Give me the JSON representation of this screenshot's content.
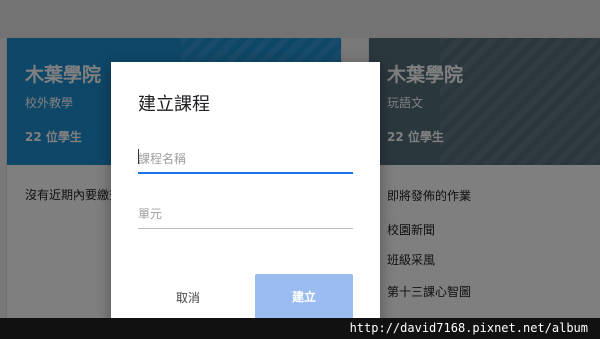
{
  "left_card": {
    "title": "木葉學院",
    "subtitle": "校外教學",
    "student_count": "22 位學生",
    "empty_note": "沒有近期內要繳交"
  },
  "right_card": {
    "title": "木葉學院",
    "subtitle": "玩語文",
    "student_count": "22 位學生",
    "section_heading": "即將發佈的作業",
    "assignments": [
      "校園新聞",
      "班級采風",
      "第十三課心智圖"
    ]
  },
  "dialog": {
    "title": "建立課程",
    "course_name_placeholder": "課程名稱",
    "section_placeholder": "單元",
    "cancel_label": "取消",
    "create_label": "建立"
  },
  "watermark": "http://david7168.pixnet.net/album",
  "colors": {
    "left_banner": "#1f8fd0",
    "right_banner": "#546e7a",
    "primary": "#1a73e8",
    "create_button_disabled": "#9bbcf0"
  }
}
